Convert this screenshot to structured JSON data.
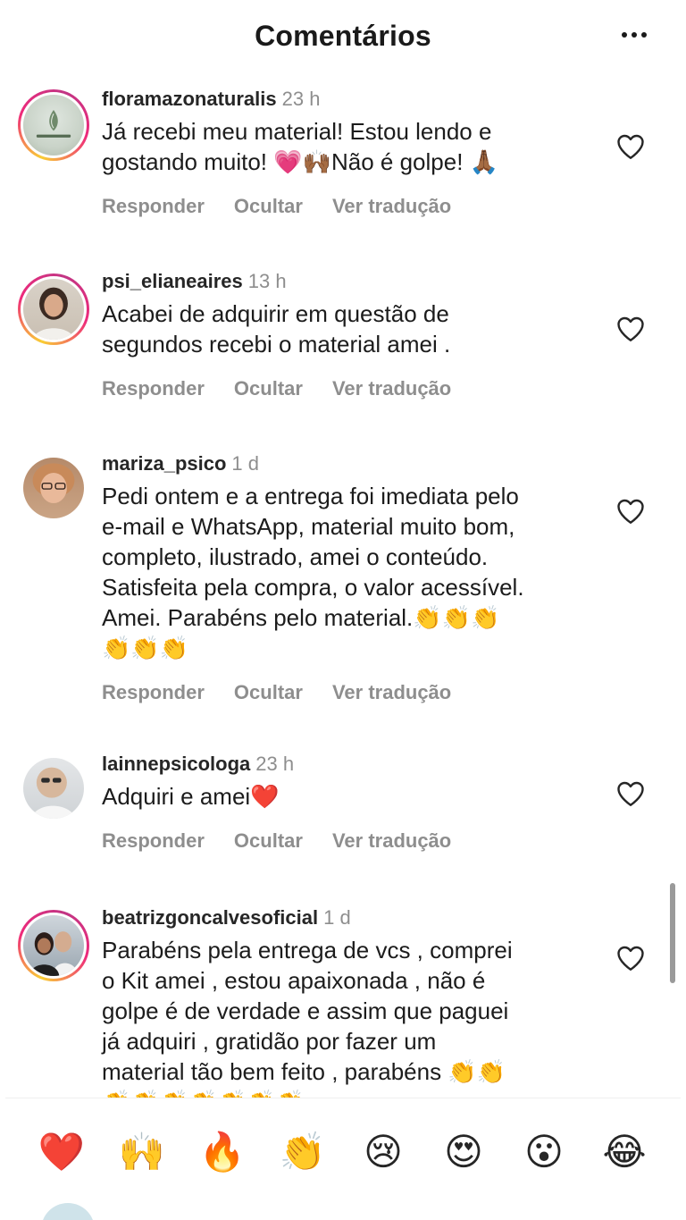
{
  "header": {
    "title": "Comentários",
    "more_icon": "more-horizontal-icon"
  },
  "actions": {
    "reply": "Responder",
    "hide": "Ocultar",
    "translate": "Ver tradução"
  },
  "comments": [
    {
      "username": "floramazonaturalis",
      "time": "23 h",
      "text": "Já recebi meu material! Estou lendo e\ngostando muito! 💗🙌🏾Não é golpe! 🙏🏾",
      "story_ring": true
    },
    {
      "username": "psi_elianeaires",
      "time": "13 h",
      "text": "Acabei de adquirir em questão de\nsegundos recebi o material amei .",
      "story_ring": true
    },
    {
      "username": "mariza_psico",
      "time": "1 d",
      "text": "Pedi ontem e a entrega foi imediata pelo\ne-mail e WhatsApp,  material muito bom,\ncompleto, ilustrado, amei o conteúdo.\nSatisfeita pela compra, o valor acessível.\nAmei. Parabéns pelo material.👏👏👏\n👏👏👏",
      "story_ring": false
    },
    {
      "username": "lainnepsicologa",
      "time": "23 h",
      "text": "Adquiri e amei❤️",
      "story_ring": false
    },
    {
      "username": "beatrizgoncalvesoficial",
      "time": "1 d",
      "text": "Parabéns pela entrega de vcs , comprei\no Kit amei , estou apaixonada , não é\ngolpe é de verdade e assim que paguei\njá  adquiri , gratidão por fazer um\nmaterial tão bem feito , parabéns 👏👏\n👏👏👏👏👏👏👏",
      "story_ring": true
    }
  ],
  "reactions": [
    "❤️",
    "🙌",
    "🔥",
    "👏",
    "😢",
    "😍",
    "😮",
    "😂"
  ],
  "colors": {
    "accent_ring_start": "#f9ce34",
    "accent_ring_mid": "#ee2a7b",
    "muted_text": "#8e8e8e"
  }
}
